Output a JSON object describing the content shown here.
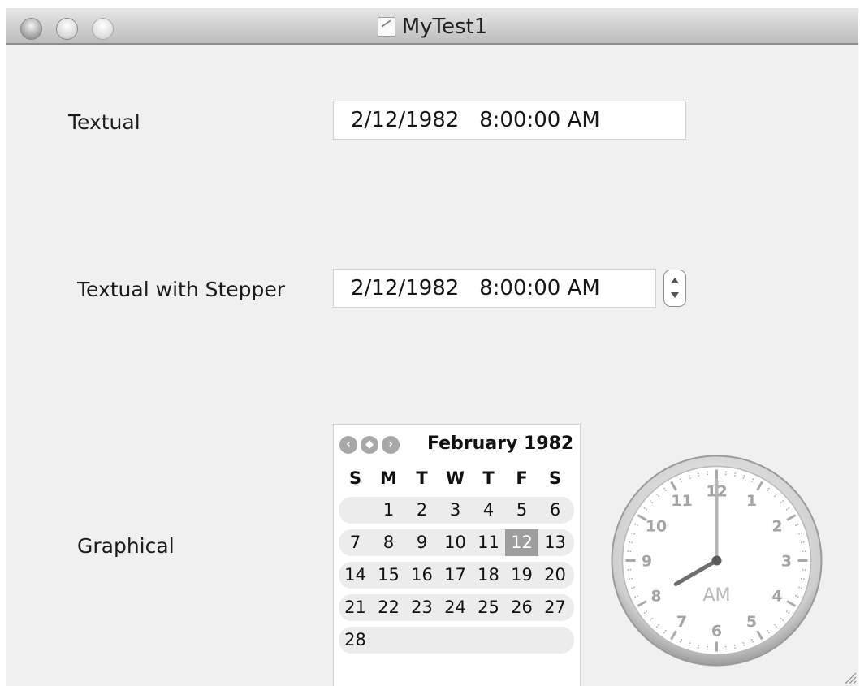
{
  "window": {
    "title": "MyTest1"
  },
  "fields": {
    "textual_label": "Textual",
    "textual_value": "2/12/1982   8:00:00 AM",
    "stepper_label": "Textual with Stepper",
    "stepper_value": "2/12/1982   8:00:00 AM",
    "graphical_label": "Graphical"
  },
  "calendar": {
    "month_year": "February 1982",
    "weekdays": [
      "S",
      "M",
      "T",
      "W",
      "T",
      "F",
      "S"
    ],
    "weeks": [
      [
        "",
        "1",
        "2",
        "3",
        "4",
        "5",
        "6"
      ],
      [
        "7",
        "8",
        "9",
        "10",
        "11",
        "12",
        "13"
      ],
      [
        "14",
        "15",
        "16",
        "17",
        "18",
        "19",
        "20"
      ],
      [
        "21",
        "22",
        "23",
        "24",
        "25",
        "26",
        "27"
      ],
      [
        "28",
        "",
        "",
        "",
        "",
        "",
        ""
      ]
    ],
    "selected_day": "12",
    "nav": {
      "prev": "‹",
      "today": "◆",
      "next": "›"
    }
  },
  "clock": {
    "numbers": [
      "12",
      "1",
      "2",
      "3",
      "4",
      "5",
      "6",
      "7",
      "8",
      "9",
      "10",
      "11"
    ],
    "period": "AM",
    "hour": 8,
    "minute": 0
  },
  "colors": {
    "selection": "#9e9e9e",
    "window_background": "#f0f0f0"
  }
}
